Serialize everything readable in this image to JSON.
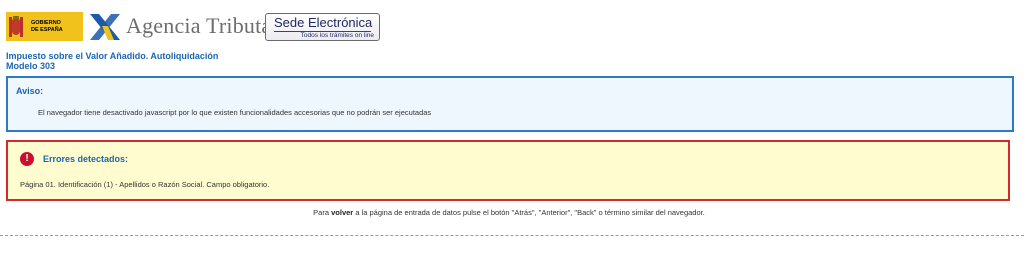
{
  "header": {
    "gov_logo_text": [
      "GOBIERNO",
      "DE ESPAÑA"
    ],
    "agency_name": "Agencia Tributaria",
    "sede_title": "Sede Electrónica",
    "sede_subtitle": "Todos los trámites on line",
    "colors": {
      "gov_yellow": "#f1c21b",
      "agency_gray": "#6d6d6d",
      "sede_navy": "#1f2a63",
      "sede_red": "#b0132c"
    }
  },
  "page": {
    "title_line1": "Impuesto sobre el Valor Añadido. Autoliquidación",
    "title_line2": "Modelo 303",
    "title_color": "#1b66b0"
  },
  "aviso": {
    "title": "Aviso:",
    "text": "El navegador tiene desactivado javascript por lo que existen funcionalidades accesorias que no podrán ser ejecutadas",
    "border_color": "#2f79c5",
    "background": "#eef6fe"
  },
  "errores": {
    "icon": "exclamation-circle-icon",
    "icon_glyph": "!",
    "title": "Errores detectados:",
    "text": "Página 01. Identificación (1) - Apellidos o Razón Social. Campo obligatorio.",
    "border_color": "#d22b2b",
    "background": "#fffdd0"
  },
  "footer": {
    "volver_prefix": "Para",
    "volver_bold": "volver",
    "volver_suffix": "a la página de entrada de datos pulse el botón \"Atrás\", \"Anterior\", \"Back\" o término similar del navegador."
  }
}
